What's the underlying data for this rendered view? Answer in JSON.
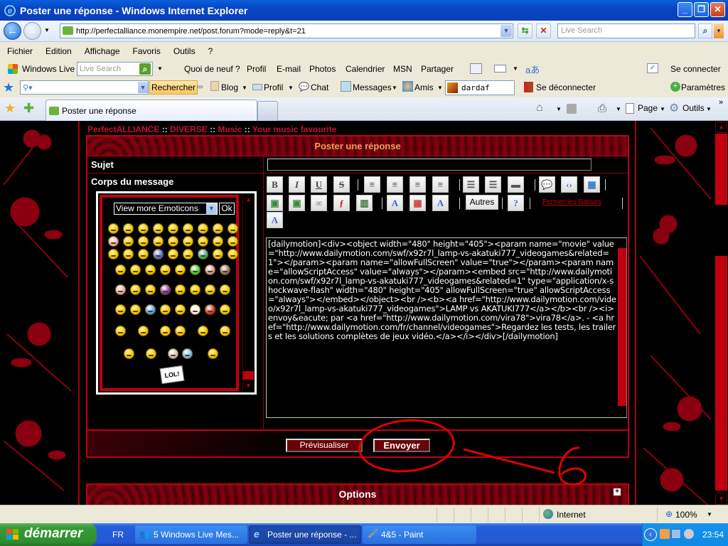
{
  "window": {
    "title": "Poster une réponse - Windows Internet Explorer",
    "controls": {
      "minimize": "_",
      "restore": "❐",
      "close": "✕"
    }
  },
  "address_bar": {
    "url": "http://perfectalliance.monempire.net/post.forum?mode=reply&t=21",
    "search_placeholder": "Live Search"
  },
  "menu": [
    "Fichier",
    "Edition",
    "Affichage",
    "Favoris",
    "Outils",
    "?"
  ],
  "live_toolbar": {
    "brand": "Windows Live",
    "search_placeholder": "Live Search",
    "links": [
      "Quoi de neuf ?",
      "Profil",
      "E-mail",
      "Photos",
      "Calendrier",
      "MSN",
      "Partager"
    ],
    "connect": "Se connecter"
  },
  "toolbar2": {
    "search_button": "Rechercher",
    "items": [
      "Blog",
      "Profil",
      "Chat",
      "Messages",
      "Amis"
    ],
    "username": "dardaf",
    "logout": "Se déconnecter",
    "settings": "Paramètres"
  },
  "tabs": {
    "active": "Poster une réponse",
    "commands": [
      "Page",
      "Outils"
    ]
  },
  "forum": {
    "breadcrumb": [
      "PerfectALLIANCE",
      "DIVERSE",
      "Music",
      "Your music favourite"
    ],
    "breadcrumb_sep": "::",
    "panel_title": "Poster une réponse",
    "subject_label": "Sujet",
    "subject_value": "",
    "body_label": "Corps du message",
    "emoticons_select": "View more Emoticons",
    "emoticons_ok": "Ok",
    "lol_sign": "LOL!",
    "toolbar_buttons": [
      {
        "name": "bold",
        "glyph": "B"
      },
      {
        "name": "italic",
        "glyph": "I"
      },
      {
        "name": "underline",
        "glyph": "U"
      },
      {
        "name": "strike",
        "glyph": "S"
      },
      {
        "name": "align-left",
        "glyph": "≡"
      },
      {
        "name": "align-center",
        "glyph": "≡"
      },
      {
        "name": "align-right",
        "glyph": "≡"
      },
      {
        "name": "justify",
        "glyph": "≡"
      },
      {
        "name": "bullet-list",
        "glyph": "☰"
      },
      {
        "name": "numbered-list",
        "glyph": "☰"
      },
      {
        "name": "hr",
        "glyph": "▬"
      },
      {
        "name": "quote",
        "glyph": "💬"
      },
      {
        "name": "code",
        "glyph": "‹›"
      },
      {
        "name": "table",
        "glyph": "▦"
      },
      {
        "name": "image-upload",
        "glyph": "▣"
      },
      {
        "name": "image",
        "glyph": "▣"
      },
      {
        "name": "link",
        "glyph": "∞"
      },
      {
        "name": "flash",
        "glyph": "ƒ"
      },
      {
        "name": "video",
        "glyph": "▥"
      },
      {
        "name": "font-size",
        "glyph": "A"
      },
      {
        "name": "color",
        "glyph": "▦"
      },
      {
        "name": "font",
        "glyph": "A"
      },
      {
        "name": "help",
        "glyph": "?"
      },
      {
        "name": "remove-format",
        "glyph": "A"
      }
    ],
    "autres": "Autres",
    "close_tags": "Fermer les Balises",
    "message": "[dailymotion]<div><object width=\"480\" height=\"405\"><param name=\"movie\" value=\"http://www.dailymotion.com/swf/x92r7l_lamp-vs-akatuki777_videogames&related=1\"></param><param name=\"allowFullScreen\" value=\"true\"></param><param name=\"allowScriptAccess\" value=\"always\"></param><embed src=\"http://www.dailymotion.com/swf/x92r7l_lamp-vs-akatuki777_videogames&related=1\" type=\"application/x-shockwave-flash\" width=\"480\" height=\"405\" allowFullScreen=\"true\" allowScriptAccess=\"always\"></embed></object><br /><b><a href=\"http://www.dailymotion.com/video/x92r7l_lamp-vs-akatuki777_videogames\">LAMP vs AKATUKI777</a></b><br /><i>envoy&eacute; par <a href=\"http://www.dailymotion.com/vira78\">vira78</a>. - <a href=\"http://www.dailymotion.com/fr/channel/videogames\">Regardez les tests, les trailers et les solutions complètes de jeux vidéo.</a></i></div>[/dailymotion]",
    "preview_button": "Prévisualiser",
    "send_button": "Envoyer",
    "options_title": "Options",
    "annotation_number": "6"
  },
  "status_bar": {
    "zone": "Internet",
    "zoom": "100%"
  },
  "taskbar": {
    "start": "démarrer",
    "language": "FR",
    "tasks": [
      "5 Windows Live Mes...",
      "Poster une réponse - ...",
      "4&5 - Paint"
    ],
    "clock": "23:54"
  },
  "colors": {
    "accent_red": "#c00010",
    "breadcrumb_red": "#c8102e",
    "panel_title": "#f0a050"
  }
}
